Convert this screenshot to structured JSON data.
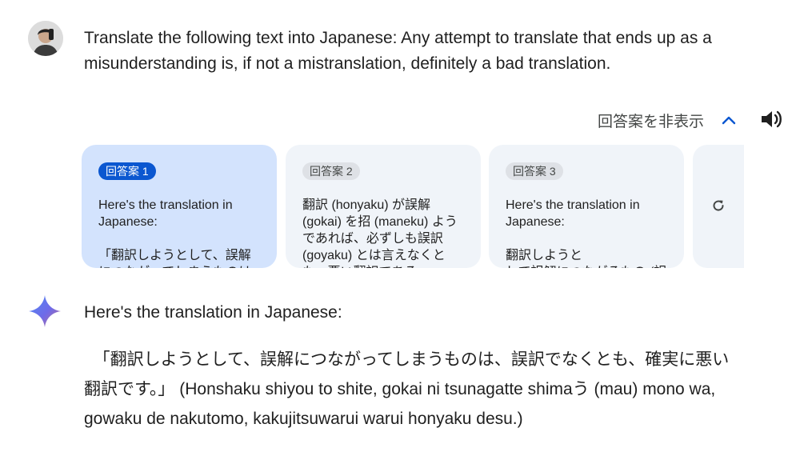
{
  "user": {
    "avatar_icon": "user-avatar",
    "prompt": "Translate the following text into Japanese: Any attempt to translate that ends up as a misunderstanding is, if not a mistranslation, definitely a bad translation."
  },
  "drafts_toggle": {
    "label": "回答案を非表示",
    "icon": "chevron-up-icon",
    "accent": "#0b57d0"
  },
  "speaker_icon": "speaker-icon",
  "drafts": [
    {
      "label": "回答案 1",
      "preview": "Here's the translation in Japanese:\n\n「翻訳しようとして、誤解につながってしまうものは",
      "active": true
    },
    {
      "label": "回答案 2",
      "preview": "翻訳 (honyaku) が誤解 (gokai) を招 (maneku) ようであれば、必ずしも誤訳 (goyaku) とは言えなくとも、悪い翻訳である",
      "active": false
    },
    {
      "label": "回答案 3",
      "preview": "Here's the translation in Japanese:\n\n翻訳しようと\nして誤解につながるもの (誤訳",
      "active": false
    }
  ],
  "regenerate_icon": "refresh-icon",
  "response": {
    "icon": "gemini-sparkle-icon",
    "intro": "Here's the translation in Japanese:",
    "body": "  「翻訳しようとして、誤解につながってしまうものは、誤訳でなくとも、確実に悪い翻訳です。」 (Honshaku shiyou to shite, gokai ni tsunagatte shimaう (mau) mono wa, gowaku de nakutomo, kakujitsuwarui warui honyaku desu.)"
  },
  "colors": {
    "active_card_bg": "#d3e3fd",
    "card_bg": "#f0f4f9",
    "active_badge_bg": "#0b57d0",
    "badge_bg": "#dee1e6"
  }
}
